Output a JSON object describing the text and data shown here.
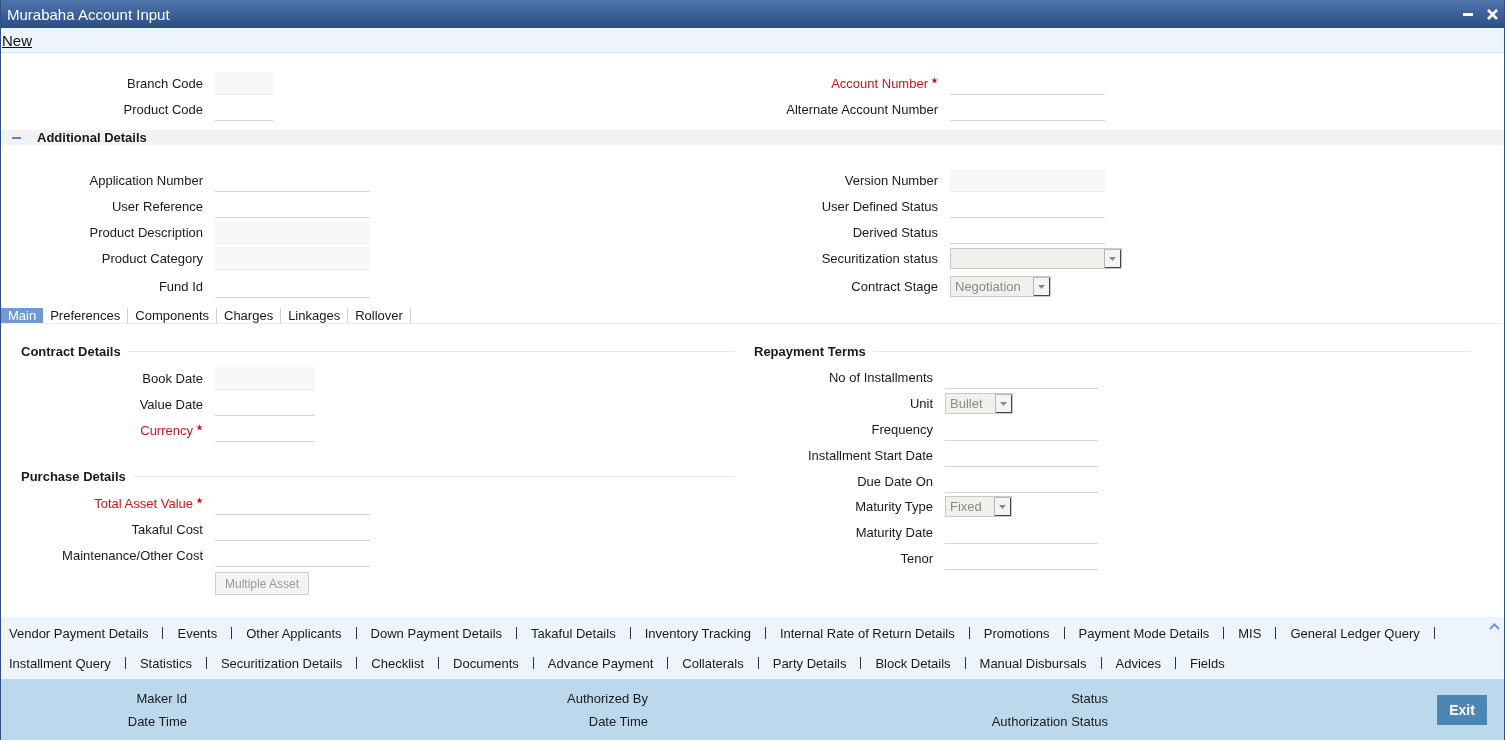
{
  "window": {
    "title": "Murabaha Account Input"
  },
  "toolbar": {
    "new_link": "New"
  },
  "header": {
    "left": [
      {
        "label": "Branch Code",
        "kind": "readonly",
        "required": false
      },
      {
        "label": "Product Code",
        "kind": "input",
        "required": false
      }
    ],
    "right": [
      {
        "label": "Account Number",
        "kind": "input",
        "required": true
      },
      {
        "label": "Alternate Account Number",
        "kind": "input",
        "required": false
      }
    ]
  },
  "additional_details": {
    "title": "Additional Details",
    "expanded": true,
    "left": [
      {
        "label": "Application Number",
        "kind": "input",
        "required": false
      },
      {
        "label": "User Reference",
        "kind": "input",
        "required": false
      },
      {
        "label": "Product Description",
        "kind": "readonly",
        "required": false
      },
      {
        "label": "Product Category",
        "kind": "readonly",
        "required": false
      },
      {
        "label": "Fund Id",
        "kind": "input",
        "required": false
      }
    ],
    "right": [
      {
        "label": "Version Number",
        "kind": "readonly",
        "required": false
      },
      {
        "label": "User Defined Status",
        "kind": "input",
        "required": false
      },
      {
        "label": "Derived Status",
        "kind": "input",
        "required": false
      },
      {
        "label": "Securitization status",
        "kind": "select",
        "required": false
      },
      {
        "label": "Contract Stage",
        "kind": "select",
        "value": "Negotiation",
        "required": false
      }
    ]
  },
  "tabs": [
    {
      "label": "Main",
      "selected": true
    },
    {
      "label": "Preferences",
      "selected": false
    },
    {
      "label": "Components",
      "selected": false
    },
    {
      "label": "Charges",
      "selected": false
    },
    {
      "label": "Linkages",
      "selected": false
    },
    {
      "label": "Rollover",
      "selected": false
    }
  ],
  "main_tab": {
    "left_sections": [
      {
        "title": "Contract Details",
        "fields": [
          {
            "label": "Book Date",
            "kind": "readonly",
            "required": false
          },
          {
            "label": "Value Date",
            "kind": "input",
            "required": false
          },
          {
            "label": "Currency",
            "kind": "input",
            "required": true
          }
        ]
      },
      {
        "title": "Purchase Details",
        "fields": [
          {
            "label": "Total Asset Value",
            "kind": "input",
            "required": true
          },
          {
            "label": "Takaful Cost",
            "kind": "input",
            "required": false
          },
          {
            "label": "Maintenance/Other Cost",
            "kind": "input",
            "required": false
          }
        ],
        "button": {
          "label": "Multiple Asset",
          "disabled": true
        }
      }
    ],
    "right_sections": [
      {
        "title": "Repayment Terms",
        "fields": [
          {
            "label": "No of Installments",
            "kind": "input",
            "required": false
          },
          {
            "label": "Unit",
            "kind": "select",
            "value": "Bullet",
            "required": false
          },
          {
            "label": "Frequency",
            "kind": "input",
            "required": false
          },
          {
            "label": "Installment Start Date",
            "kind": "input",
            "required": false
          },
          {
            "label": "Due Date On",
            "kind": "input",
            "required": false
          },
          {
            "label": "Maturity Type",
            "kind": "select",
            "value": "Fixed",
            "required": false
          },
          {
            "label": "Maturity Date",
            "kind": "input",
            "required": false
          },
          {
            "label": "Tenor",
            "kind": "input",
            "required": false
          }
        ]
      }
    ]
  },
  "links": [
    [
      "Vendor Payment Details",
      "Events",
      "Other Applicants",
      "Down Payment Details",
      "Takaful Details",
      "Inventory Tracking",
      "Internal Rate of Return Details",
      "Promotions",
      "Payment Mode Details",
      "MIS",
      "General Ledger Query"
    ],
    [
      "Installment Query",
      "Statistics",
      "Securitization Details",
      "Checklist",
      "Documents",
      "Advance Payment",
      "Collaterals",
      "Party Details",
      "Block Details",
      "Manual Disbursals",
      "Advices",
      "Fields"
    ]
  ],
  "footer": {
    "columns": [
      [
        "Maker Id",
        "Date Time"
      ],
      [
        "Authorized By",
        "Date Time"
      ],
      [
        "Status",
        "Authorization Status"
      ]
    ],
    "exit_button": "Exit"
  }
}
